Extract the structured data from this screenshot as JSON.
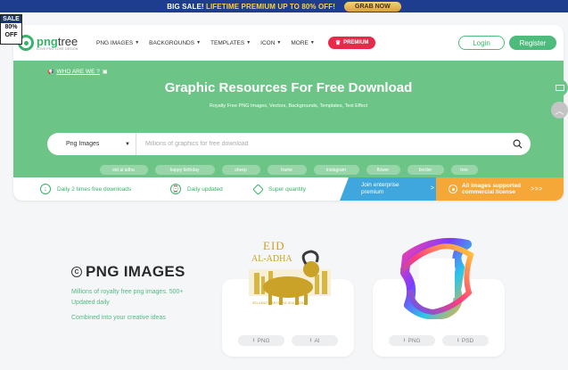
{
  "promo": {
    "big_sale": "BIG SALE!",
    "lifetime": "LIFETIME PREMIUM UP TO 80% OFF!",
    "grab_now": "GRAB NOW"
  },
  "sale_badge": {
    "line1": "SALE",
    "line2": "80%",
    "line3": "OFF"
  },
  "header": {
    "logo_name_1": "png",
    "logo_name_2": "tree",
    "logo_tagline": "LOVE PNG LOVE DESIGN",
    "nav": [
      {
        "label": "PNG IMAGES"
      },
      {
        "label": "BACKGROUNDS"
      },
      {
        "label": "TEMPLATES"
      },
      {
        "label": "ICON"
      },
      {
        "label": "MORE"
      }
    ],
    "premium_label": "PREMIUM",
    "login_label": "Login",
    "register_label": "Register"
  },
  "hero": {
    "who_label": "WHO ARE WE ?",
    "title": "Graphic Resources For Free Download",
    "subtitle": "Royalty Free PNG Images, Vectors, Backgrounds, Templates, Text Effect",
    "search_type": "Png Images",
    "search_placeholder": "Millions of graphics for free download",
    "tags": [
      "eid al adha",
      "happy birthday",
      "sheep",
      "frame",
      "instagram",
      "flower",
      "border",
      "tree"
    ]
  },
  "features": {
    "downloads": "Daily 2 times free downloads",
    "updated": "Daily updated",
    "quality": "Super quantity",
    "enterprise_line1": "Join enterprise",
    "enterprise_line2": "premium",
    "enterprise_arrow": ">",
    "license_line1": "All images supported",
    "license_line2": "commercial license",
    "license_arrows": ">>>"
  },
  "section": {
    "title": "PNG IMAGES",
    "desc1": "Millions of royalty free png images. 500+ Updated daily",
    "desc2": "Combined into your creative ideas"
  },
  "cards": [
    {
      "art_title": "EID",
      "art_sub": "AL-ADHA",
      "art_caption": "SELAMAT HARI RAYA IDUL ADHA",
      "fmt1": "PNG",
      "fmt2": "AI"
    },
    {
      "fmt1": "PNG",
      "fmt2": "PSD"
    }
  ],
  "colors": {
    "brand_green": "#6cc586",
    "promo_blue": "#1f3d8f",
    "premium_red": "#e8294a",
    "enterprise_blue": "#3fa7de",
    "license_orange": "#f5a838"
  }
}
